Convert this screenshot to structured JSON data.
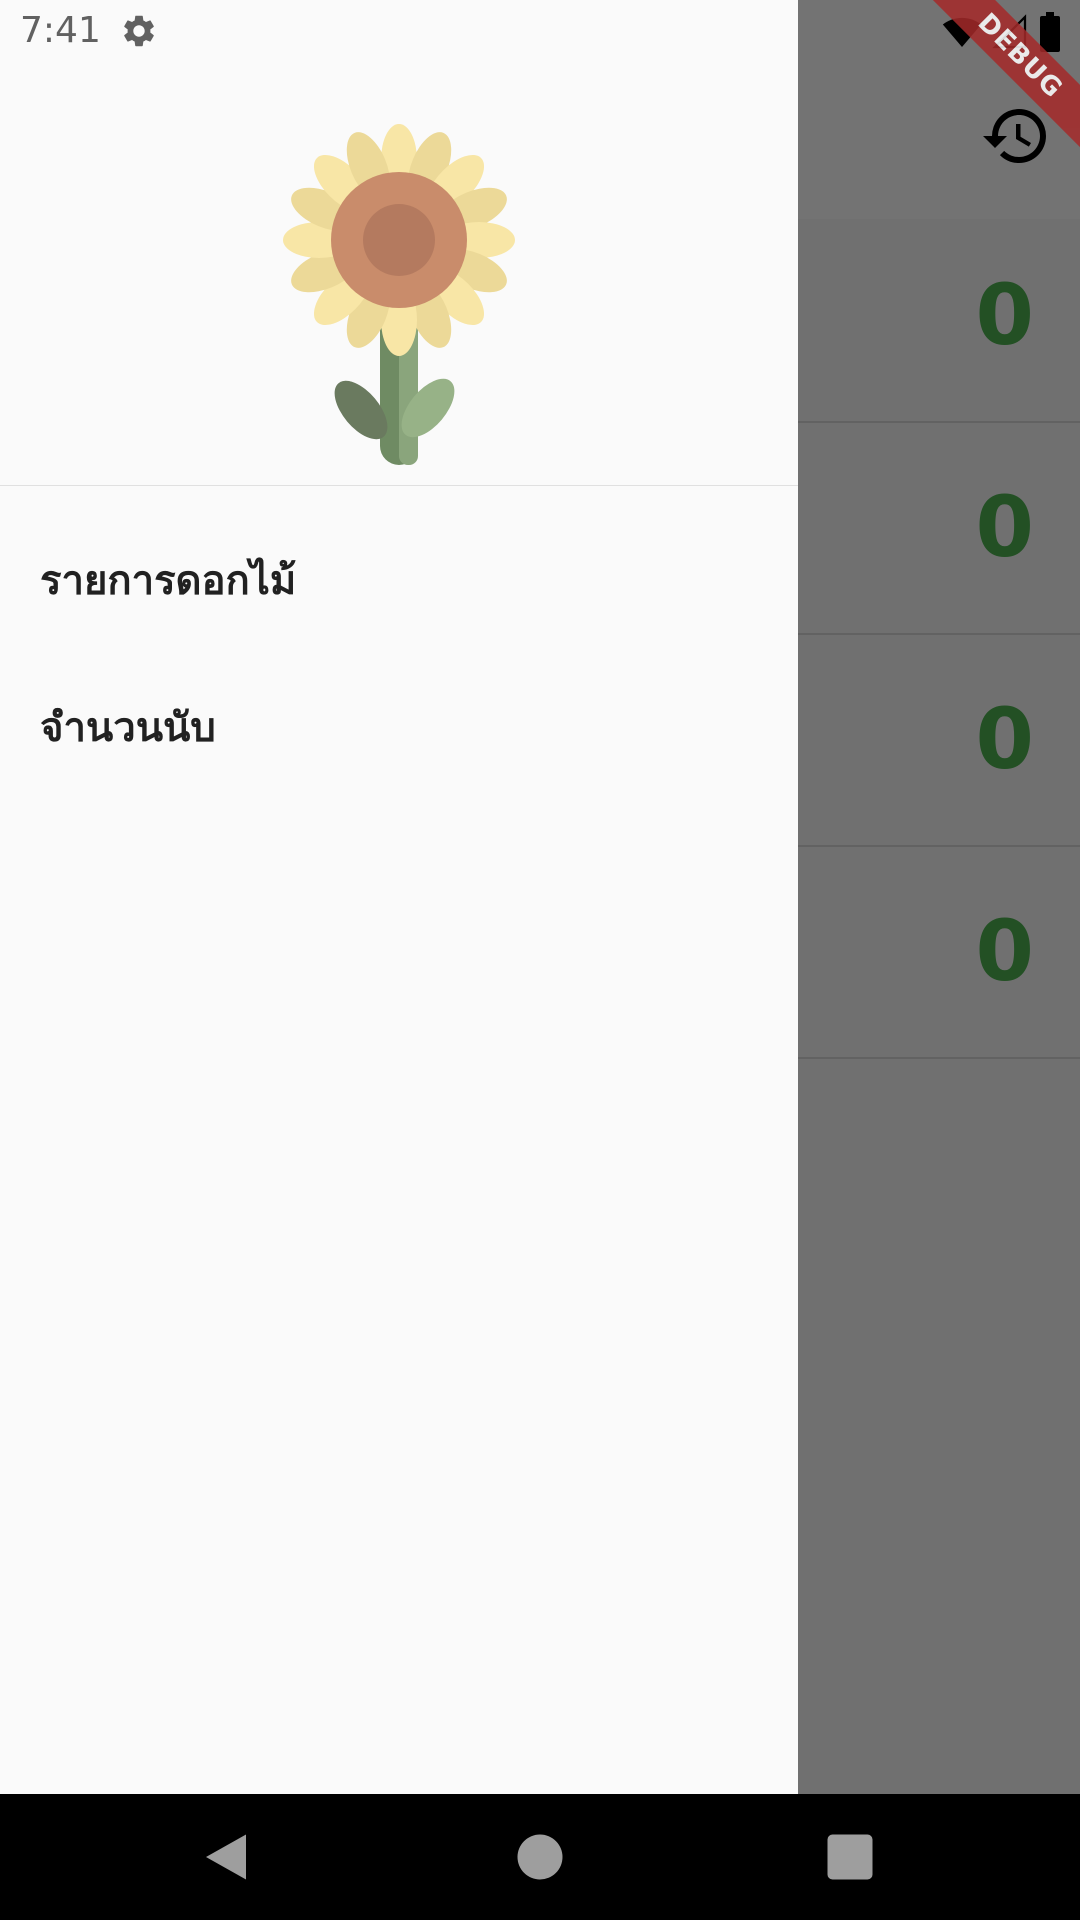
{
  "status_bar": {
    "time": "7:41",
    "icons": [
      "settings-icon",
      "wifi-icon",
      "signal-icon",
      "battery-icon"
    ]
  },
  "debug_banner": {
    "label": "DEBUG"
  },
  "app_bar": {
    "action_icon": "history-icon"
  },
  "counts": [
    {
      "value": "0"
    },
    {
      "value": "0"
    },
    {
      "value": "0"
    },
    {
      "value": "0"
    }
  ],
  "drawer": {
    "header_image": "sunflower-logo",
    "items": [
      {
        "label": "รายการดอกไม้"
      },
      {
        "label": "จำนวนนับ"
      }
    ]
  },
  "nav_bar": {
    "icons": [
      "back-icon",
      "home-icon",
      "recents-icon"
    ]
  },
  "colors": {
    "count_green": "#4caf50",
    "debug_red": "#a52a2a",
    "drawer_bg": "#fafafa",
    "scrim": "rgba(0,0,0,0.54)"
  }
}
